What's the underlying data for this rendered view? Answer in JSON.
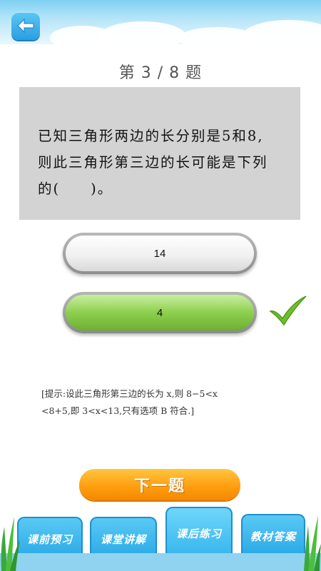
{
  "header": {
    "back_icon": "back-arrow-icon"
  },
  "question": {
    "counter": "第 3 / 8 题",
    "lines": [
      "已知三角形两边的长分别是5和8,",
      "则此三角形第三边的长可能是下列",
      "的(　　)。"
    ]
  },
  "options": [
    {
      "label": "14",
      "state": "default"
    },
    {
      "label": "4",
      "state": "correct"
    }
  ],
  "correct_icon": "checkmark-icon",
  "hint": {
    "line1": "[提示:设此三角形第三边的长为 x,则 8−5<x",
    "line2": "<8+5,即 3<x<13,只有选项 B 符合.]"
  },
  "next_button": {
    "label": "下一题"
  },
  "tabs": [
    {
      "label": "课前预习",
      "active": false
    },
    {
      "label": "课堂讲解",
      "active": false
    },
    {
      "label": "课后练习",
      "active": true
    },
    {
      "label": "教材答案",
      "active": false
    }
  ],
  "colors": {
    "accent_orange": "#ff9f10",
    "tab_blue": "#28a8e6",
    "correct_green": "#8dcf4e",
    "check_green": "#6fbf2c"
  }
}
